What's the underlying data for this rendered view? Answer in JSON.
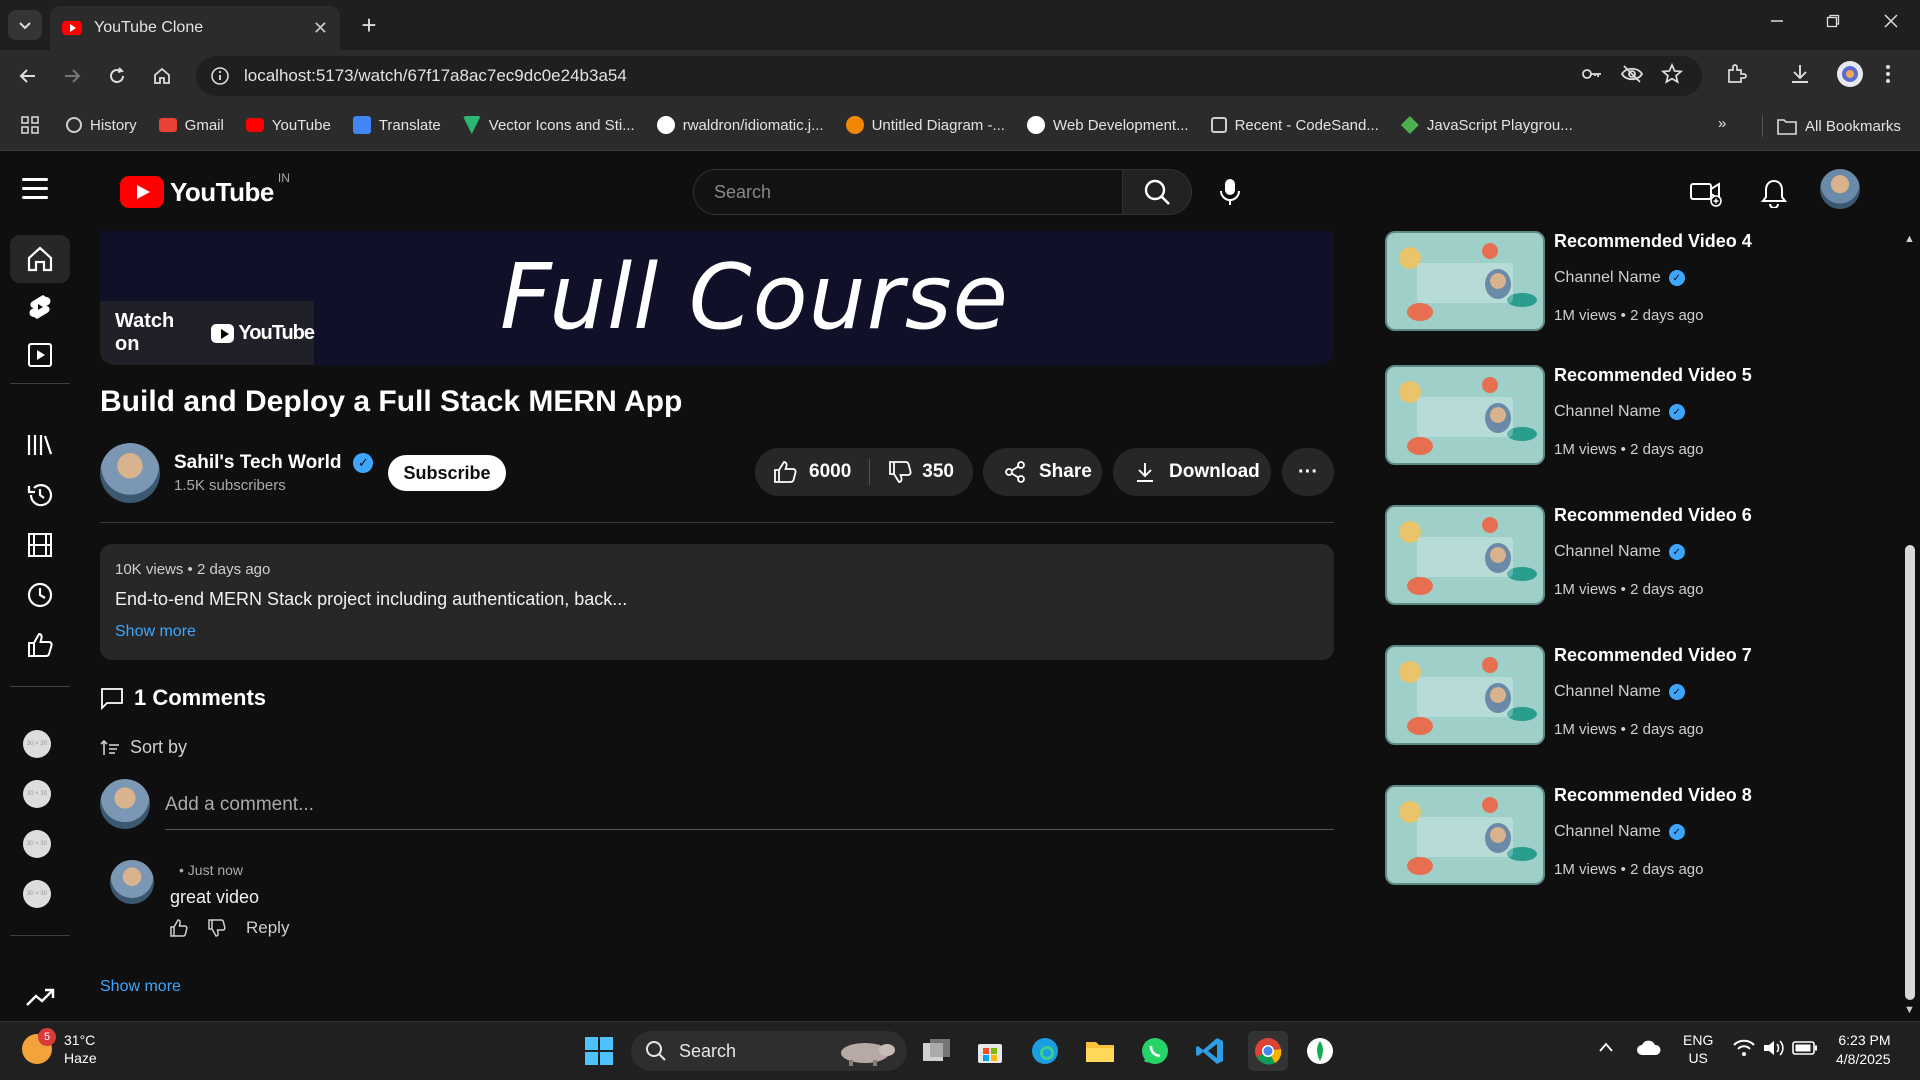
{
  "browser": {
    "tab_title": "YouTube Clone",
    "tab_close": "✕",
    "new_tab": "+",
    "url": "localhost:5173/watch/67f17a8ac7ec9dc0e24b3a54",
    "bookmarks": [
      {
        "label": "History",
        "color": "#cfcfcf"
      },
      {
        "label": "Gmail",
        "color": "#ea4335"
      },
      {
        "label": "YouTube",
        "color": "#ff0000"
      },
      {
        "label": "Translate",
        "color": "#4285f4"
      },
      {
        "label": "Vector Icons and Sti...",
        "color": "#2bb673"
      },
      {
        "label": "rwaldron/idiomatic.j...",
        "color": "#ffffff"
      },
      {
        "label": "Untitled Diagram -...",
        "color": "#f08705"
      },
      {
        "label": "Web Development...",
        "color": "#ffffff"
      },
      {
        "label": "Recent - CodeSand...",
        "color": "#cfcfcf"
      },
      {
        "label": "JavaScript Playgrou...",
        "color": "#4caf50"
      }
    ],
    "bookmarks_overflow": "»",
    "all_bookmarks": "All Bookmarks"
  },
  "header": {
    "logo_text": "YouTube",
    "country_code": "IN",
    "search_placeholder": "Search"
  },
  "player": {
    "overlay_text": "Full Course",
    "watch_on": "Watch on",
    "watch_on_brand": "YouTube"
  },
  "video": {
    "title": "Build and Deploy a Full Stack MERN App",
    "channel_name": "Sahil's Tech World",
    "subscribers": "1.5K subscribers",
    "subscribe_label": "Subscribe",
    "likes": "6000",
    "dislikes": "350",
    "share_label": "Share",
    "download_label": "Download",
    "more_label": "···",
    "meta": "10K views • 2 days ago",
    "description": "End-to-end MERN Stack project including authentication, back...",
    "show_more_desc": "Show more"
  },
  "comments": {
    "heading": "1 Comments",
    "sort_by": "Sort by",
    "add_placeholder": "Add a comment...",
    "items": [
      {
        "time": "• Just now",
        "text": "great video",
        "reply": "Reply"
      }
    ],
    "show_more": "Show more"
  },
  "recommended": [
    {
      "title": "Recommended Video 4",
      "channel": "Channel Name",
      "meta": "1M views • 2 days ago"
    },
    {
      "title": "Recommended Video 5",
      "channel": "Channel Name",
      "meta": "1M views • 2 days ago"
    },
    {
      "title": "Recommended Video 6",
      "channel": "Channel Name",
      "meta": "1M views • 2 days ago"
    },
    {
      "title": "Recommended Video 7",
      "channel": "Channel Name",
      "meta": "1M views • 2 days ago"
    },
    {
      "title": "Recommended Video 8",
      "channel": "Channel Name",
      "meta": "1M views • 2 days ago"
    }
  ],
  "sidebar_subs_label": "30 × 30",
  "taskbar": {
    "weather_badge": "5",
    "temperature": "31°C",
    "condition": "Haze",
    "search_label": "Search",
    "lang_top": "ENG",
    "lang_bottom": "US",
    "time": "6:23 PM",
    "date": "4/8/2025"
  },
  "colors": {
    "accent_blue": "#3ea6ff",
    "brand_red": "#ff0000",
    "background": "#0f0f0f",
    "surface": "#272727"
  }
}
